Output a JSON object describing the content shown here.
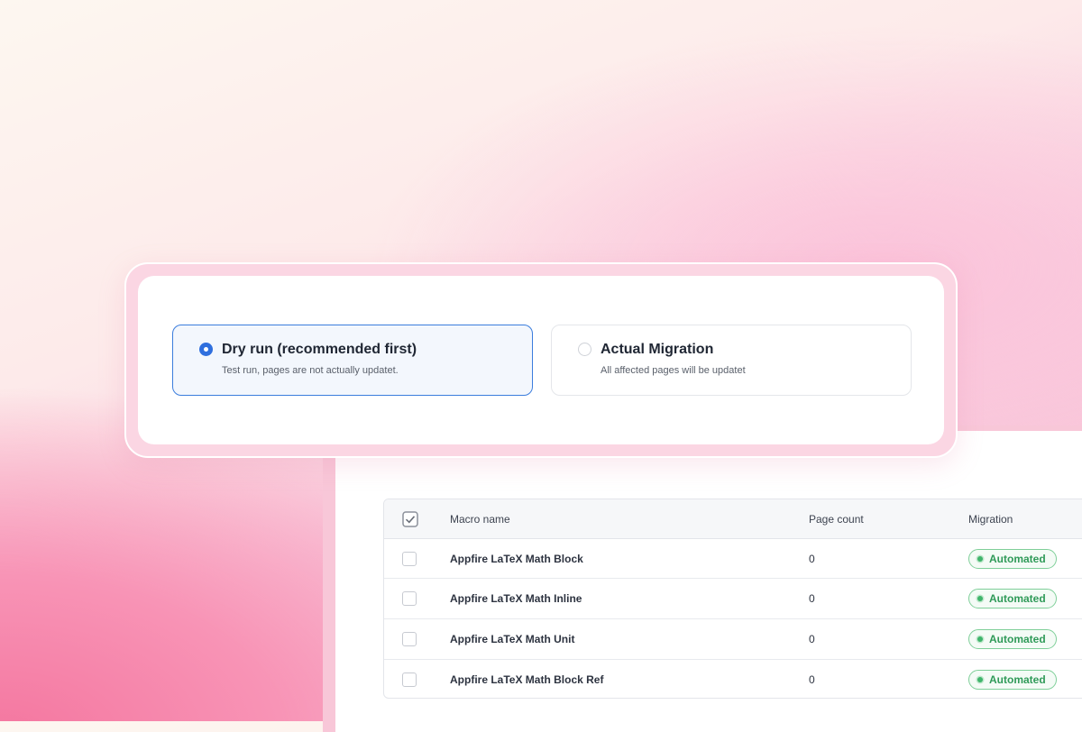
{
  "mode_selector": {
    "options": [
      {
        "title": "Dry run (recommended first)",
        "description": "Test run, pages are not actually updatet.",
        "selected": true
      },
      {
        "title": "Actual Migration",
        "description": "All affected pages will be updatet",
        "selected": false
      }
    ]
  },
  "table": {
    "headers": {
      "name": "Macro name",
      "count": "Page count",
      "migration": "Migration"
    },
    "rows": [
      {
        "name": "Appfire LaTeX Math Block",
        "count": "0",
        "migration": "Automated"
      },
      {
        "name": "Appfire LaTeX Math Inline",
        "count": "0",
        "migration": "Automated"
      },
      {
        "name": "Appfire LaTeX Math Unit",
        "count": "0",
        "migration": "Automated"
      },
      {
        "name": "Appfire LaTeX Math Block Ref",
        "count": "0",
        "migration": "Automated"
      }
    ]
  },
  "colors": {
    "accent": "#2f6fde",
    "success": "#2f9a58",
    "background_pink": "#f894b6"
  }
}
